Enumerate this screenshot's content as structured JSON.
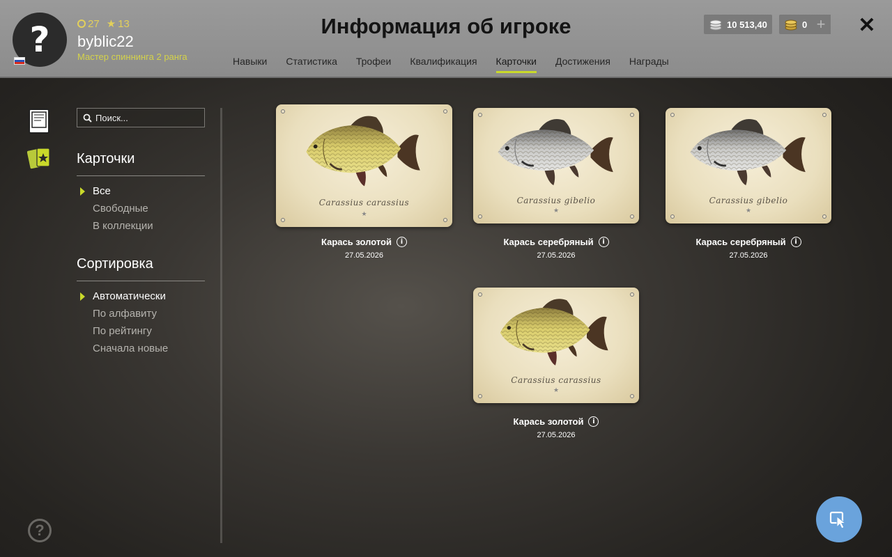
{
  "player": {
    "avatar_glyph": "?",
    "coins_stat": "27",
    "stars_stat": "13",
    "username": "byblic22",
    "rank": "Мастер спиннинга 2 ранга"
  },
  "header": {
    "title": "Информация об игроке",
    "silver": "10 513,40",
    "gold": "0",
    "plus": "+",
    "close": "✕"
  },
  "tabs": [
    {
      "label": "Навыки"
    },
    {
      "label": "Статистика"
    },
    {
      "label": "Трофеи"
    },
    {
      "label": "Квалификация"
    },
    {
      "label": "Карточки",
      "active": true
    },
    {
      "label": "Достижения"
    },
    {
      "label": "Награды"
    }
  ],
  "sidebar": {
    "search_placeholder": "Поиск...",
    "cards_title": "Карточки",
    "filters": [
      "Все",
      "Свободные",
      "В коллекции"
    ],
    "sort_title": "Сортировка",
    "sorts": [
      "Автоматически",
      "По алфавиту",
      "По рейтингу",
      "Сначала новые"
    ],
    "help_glyph": "?"
  },
  "cards": [
    {
      "latin": "Carassius carassius",
      "name": "Карась золотой",
      "date": "27.05.2026",
      "fish": "golden"
    },
    {
      "latin": "Carassius gibelio",
      "name": "Карась серебряный",
      "date": "27.05.2026",
      "fish": "silver"
    },
    {
      "latin": "Carassius gibelio",
      "name": "Карась серебряный",
      "date": "27.05.2026",
      "fish": "silver"
    },
    {
      "latin": "Carassius carassius",
      "name": "Карась золотой",
      "date": "27.05.2026",
      "fish": "golden"
    }
  ],
  "colors": {
    "accent": "#c9d92a",
    "rank": "#d4d24a",
    "fab": "#6aa3dc"
  }
}
